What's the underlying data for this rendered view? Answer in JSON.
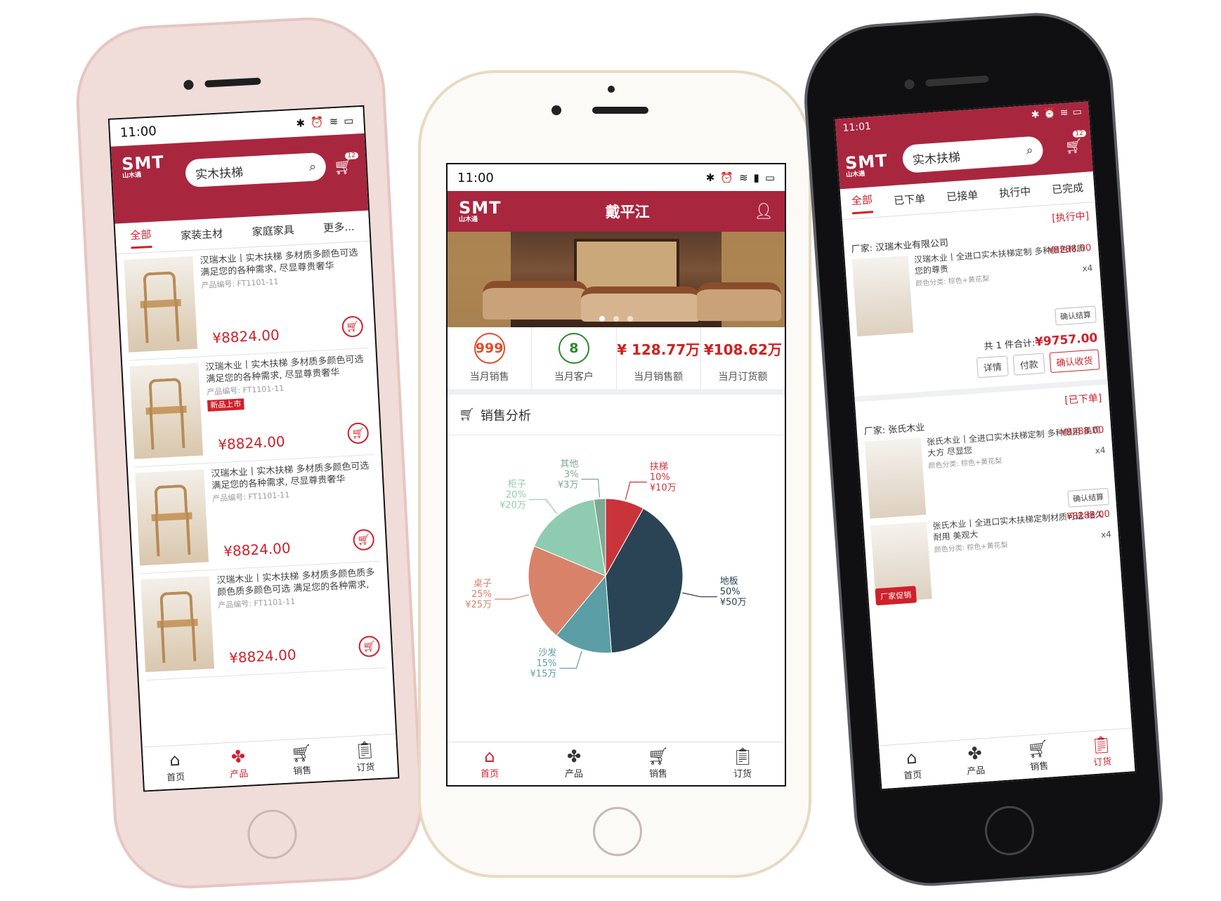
{
  "left": {
    "status_time": "11:00",
    "logo_big": "SMT",
    "logo_small": "山木通",
    "search_text": "实木扶梯",
    "cart_badge": "12",
    "categories": [
      "全部",
      "家装主材",
      "家庭家具",
      "更多..."
    ],
    "products": [
      {
        "title": "汉瑞木业丨实木扶梯 多材质多颜色可选 满足您的各种需求, 尽显尊贵奢华",
        "code": "产品编号: FT1101-11",
        "price": "¥8824.00",
        "tag": ""
      },
      {
        "title": "汉瑞木业丨实木扶梯 多材质多颜色可选 满足您的各种需求, 尽显尊贵奢华",
        "code": "产品编号: FT1101-11",
        "price": "¥8824.00",
        "tag": "新品上市"
      },
      {
        "title": "汉瑞木业丨实木扶梯 多材质多颜色可选 满足您的各种需求, 尽显尊贵奢华",
        "code": "产品编号: FT1101-11",
        "price": "¥8824.00",
        "tag": ""
      },
      {
        "title": "汉瑞木业丨实木扶梯 多材质多颜色质多颜色质多颜色可选 满足您的各种需求,",
        "code": "产品编号: FT1101-11",
        "price": "¥8824.00",
        "tag": ""
      }
    ],
    "tabs": [
      {
        "label": "首页",
        "icon": "home-icon"
      },
      {
        "label": "产品",
        "icon": "products-icon"
      },
      {
        "label": "销售",
        "icon": "cart-icon"
      },
      {
        "label": "订货",
        "icon": "clipboard-icon"
      }
    ]
  },
  "middle": {
    "status_time": "11:00",
    "logo_big": "SMT",
    "logo_small": "山木通",
    "header_title": "戴平江",
    "stats": [
      {
        "value": "999",
        "label": "当月销售"
      },
      {
        "value": "8",
        "label": "当月客户"
      },
      {
        "value": "¥ 128.77万",
        "label": "当月销售额"
      },
      {
        "value": "¥108.62万",
        "label": "当月订货额"
      }
    ],
    "section_title": "销售分析",
    "tabs": [
      {
        "label": "首页",
        "icon": "home-icon"
      },
      {
        "label": "产品",
        "icon": "products-icon"
      },
      {
        "label": "销售",
        "icon": "cart-icon"
      },
      {
        "label": "订货",
        "icon": "clipboard-icon"
      }
    ]
  },
  "chart_data": {
    "type": "pie",
    "slices": [
      {
        "name": "扶梯",
        "percent": "10%",
        "amount": "¥10万",
        "value": 10,
        "color": "#c9343a"
      },
      {
        "name": "地板",
        "percent": "50%",
        "amount": "¥50万",
        "value": 50,
        "color": "#2b4455"
      },
      {
        "name": "沙发",
        "percent": "15%",
        "amount": "¥15万",
        "value": 15,
        "color": "#5b9ea5"
      },
      {
        "name": "桌子",
        "percent": "25%",
        "amount": "¥25万",
        "value": 25,
        "color": "#d9826a"
      },
      {
        "name": "柜子",
        "percent": "20%",
        "amount": "¥20万",
        "value": 20,
        "color": "#8fcbb0"
      },
      {
        "name": "其他",
        "percent": "3%",
        "amount": "¥3万",
        "value": 3,
        "color": "#7fa892"
      }
    ]
  },
  "right": {
    "status_time": "11:01",
    "logo_big": "SMT",
    "logo_small": "山木通",
    "search_text": "实木扶梯",
    "cart_badge": "12",
    "order_tabs": [
      "全部",
      "已下单",
      "已接单",
      "执行中",
      "已完成"
    ],
    "orders": [
      {
        "state": "[执行中]",
        "vendor": "厂家: 汉瑞木业有限公司",
        "lines": [
          {
            "title": "汉瑞木业丨全进口实木扶梯定制 多种颜色材质您的尊贵",
            "spec": "颜色分类: 棕色+黄花梨",
            "price": "¥8288.00",
            "qty": "x4",
            "action": "确认结算"
          }
        ],
        "total_label": "共 1 件合计:",
        "total_value": "¥9757.00",
        "buttons": [
          "详情",
          "付款",
          "确认收货"
        ]
      },
      {
        "state": "[已下单]",
        "vendor": "厂家: 张氏木业",
        "lines": [
          {
            "title": "张氏木业丨全进口实木扶梯定制 多种颜用 美观大方 尽显您",
            "spec": "颜色分类: 棕色+黄花梨",
            "price": "¥8288.00",
            "qty": "x4",
            "action": "确认结算"
          },
          {
            "title": "张氏木业丨全进口实木扶梯定制材质可选 经久耐用 美观大",
            "spec": "颜色分类: 棕色+黄花梨",
            "price": "¥8288.00",
            "qty": "x4",
            "action": "厂家促销"
          }
        ]
      }
    ],
    "tabs": [
      {
        "label": "首页",
        "icon": "home-icon"
      },
      {
        "label": "产品",
        "icon": "products-icon"
      },
      {
        "label": "销售",
        "icon": "cart-icon"
      },
      {
        "label": "订货",
        "icon": "clipboard-icon"
      }
    ]
  }
}
